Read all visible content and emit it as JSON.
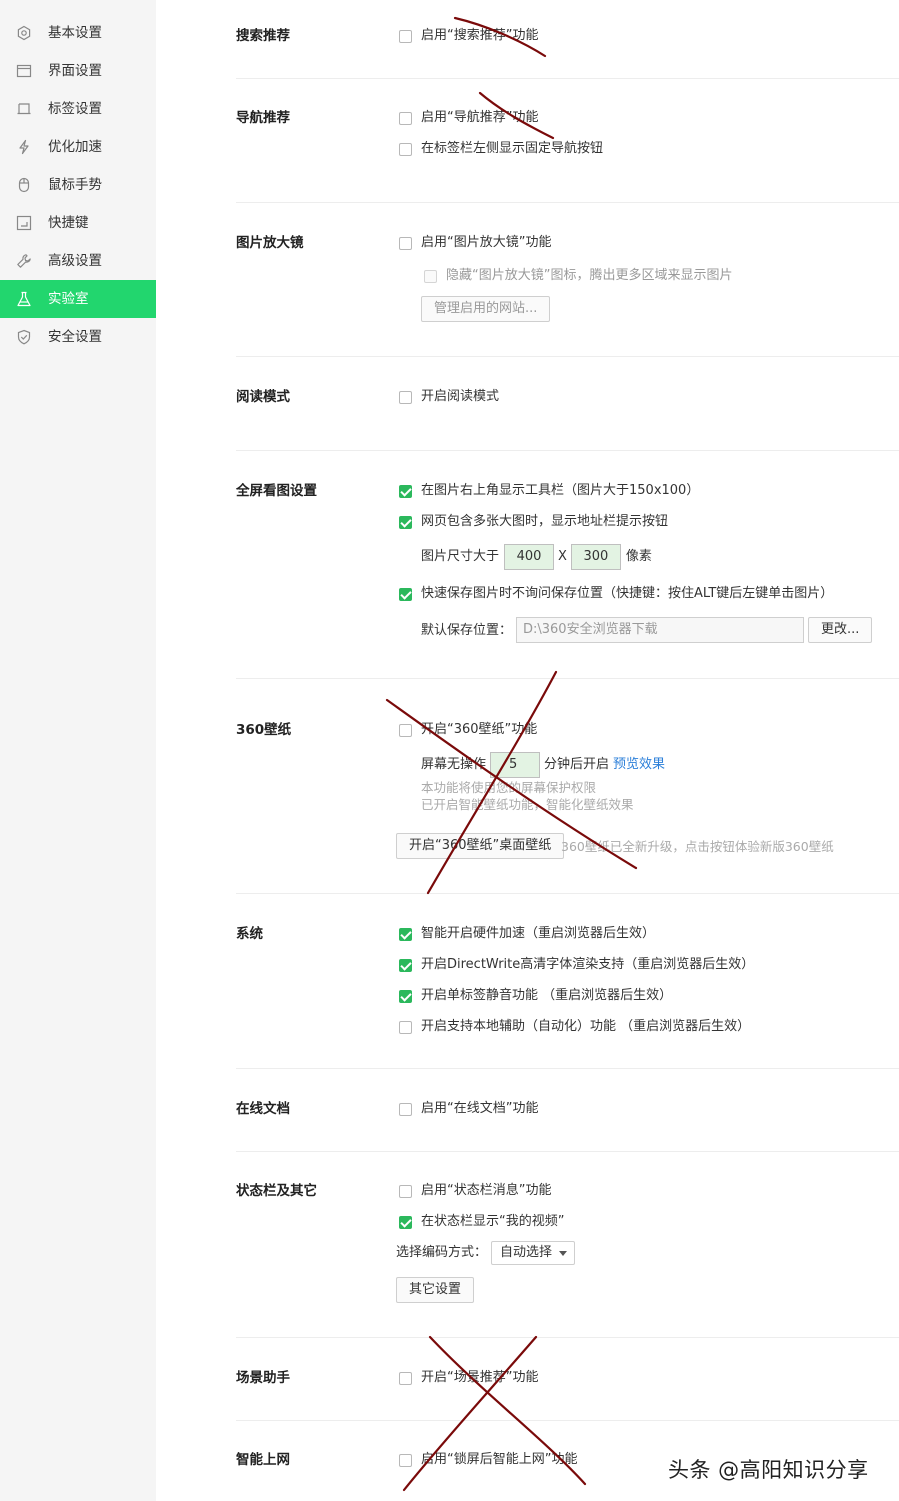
{
  "sidebar": {
    "items": [
      {
        "label": "基本设置",
        "icon": "settings-icon"
      },
      {
        "label": "界面设置",
        "icon": "window-icon"
      },
      {
        "label": "标签设置",
        "icon": "tab-icon"
      },
      {
        "label": "优化加速",
        "icon": "lightning-icon"
      },
      {
        "label": "鼠标手势",
        "icon": "mouse-icon"
      },
      {
        "label": "快捷键",
        "icon": "shortcut-icon"
      },
      {
        "label": "高级设置",
        "icon": "wrench-icon"
      },
      {
        "label": "实验室",
        "icon": "flask-icon",
        "active": true
      },
      {
        "label": "安全设置",
        "icon": "shield-icon"
      }
    ]
  },
  "sections": {
    "search": {
      "title": "搜索推荐",
      "opt1": "启用“搜索推荐”功能"
    },
    "nav": {
      "title": "导航推荐",
      "opt1": "启用“导航推荐”功能",
      "opt2": "在标签栏左侧显示固定导航按钮"
    },
    "magnifier": {
      "title": "图片放大镜",
      "opt1": "启用“图片放大镜”功能",
      "opt2": "隐藏“图片放大镜”图标，腾出更多区域来显示图片",
      "manage_button": "管理启用的网站..."
    },
    "reading": {
      "title": "阅读模式",
      "opt1": "开启阅读模式"
    },
    "fullscreen": {
      "title": "全屏看图设置",
      "opt1": "在图片右上角显示工具栏（图片大于150x100）",
      "opt2": "网页包含多张大图时，显示地址栏提示按钮",
      "size_label": "图片尺寸大于",
      "width": "400",
      "x_label": "X",
      "height": "300",
      "unit": "像素",
      "opt3": "快速保存图片时不询问保存位置（快捷键：按住ALT键后左键单击图片）",
      "save_label": "默认保存位置：",
      "save_path": "D:\\360安全浏览器下载",
      "change_button": "更改..."
    },
    "wallpaper": {
      "title": "360壁纸",
      "opt1": "开启“360壁纸”功能",
      "idle_label": "屏幕无操作",
      "minutes": "5",
      "after_label": "分钟后开启",
      "preview_link": "预览效果",
      "hint1": "本功能将使用您的屏幕保护权限",
      "hint2": "已开启智能壁纸功能，智能化壁纸效果",
      "desktop_button": "开启“360壁纸”桌面壁纸",
      "upgrade_hint": "360壁纸已全新升级，点击按钮体验新版360壁纸"
    },
    "system": {
      "title": "系统",
      "opt1": "智能开启硬件加速（重启浏览器后生效）",
      "opt2": "开启DirectWrite高清字体渲染支持（重启浏览器后生效）",
      "opt3": "开启单标签静音功能 （重启浏览器后生效）",
      "opt4": "开启支持本地辅助（自动化）功能 （重启浏览器后生效）"
    },
    "docs": {
      "title": "在线文档",
      "opt1": "启用“在线文档”功能"
    },
    "statusbar": {
      "title": "状态栏及其它",
      "opt1": "启用“状态栏消息”功能",
      "opt2": "在状态栏显示“我的视频”",
      "encoding_label": "选择编码方式：",
      "encoding_value": "自动选择",
      "other_button": "其它设置"
    },
    "scene": {
      "title": "场景助手",
      "opt1": "开启“场景推荐”功能"
    },
    "smart": {
      "title": "智能上网",
      "opt1": "启用“锁屏后智能上网”功能"
    }
  },
  "watermark": "头条 @高阳知识分享",
  "colors": {
    "accent": "#22d66e",
    "checkbox": "#2bb85c",
    "annotation": "#7a0a0a",
    "link": "#2b7fd9"
  }
}
